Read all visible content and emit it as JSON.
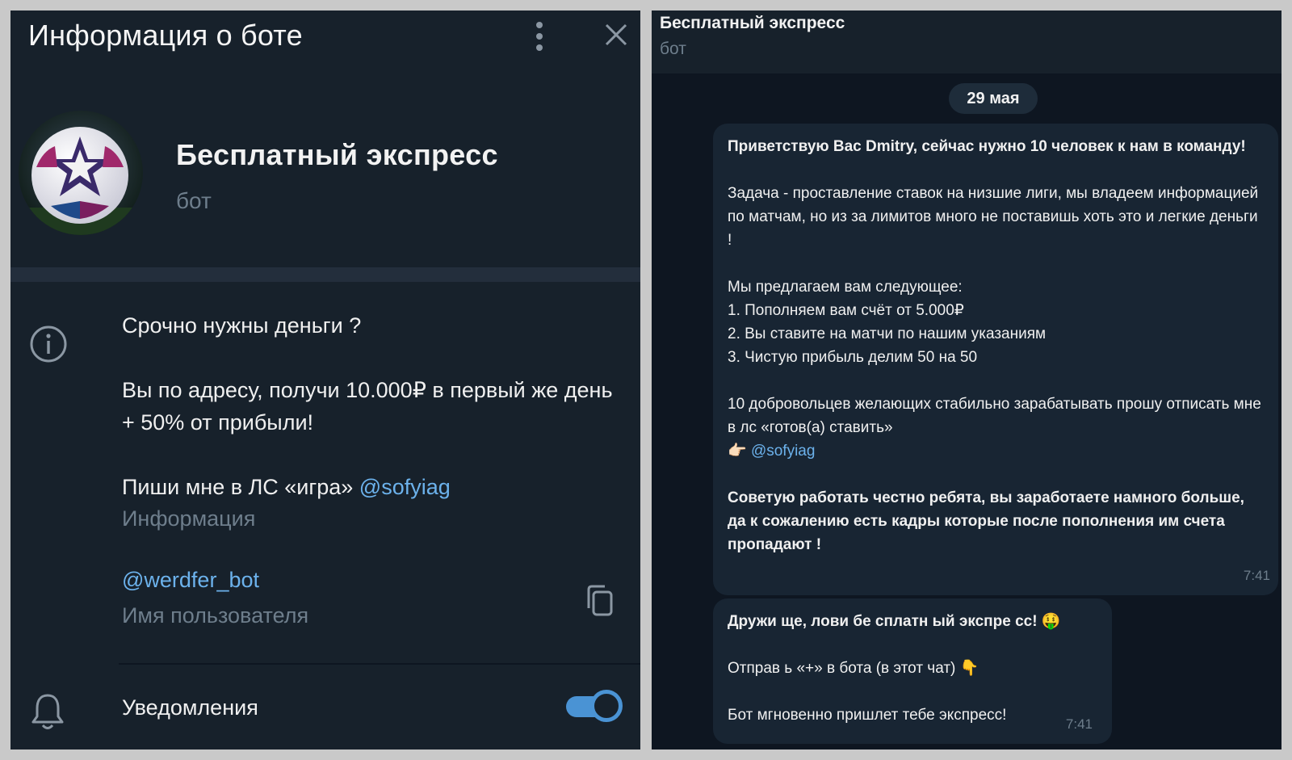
{
  "left_panel": {
    "title": "Информация о боте",
    "profile": {
      "name": "Бесплатный экспресс",
      "subtitle": "бот"
    },
    "description": {
      "line1": "Срочно нужны деньги ?",
      "line2": "Вы по адресу, получи 10.000₽ в первый же день + 50% от прибыли!",
      "line3_prefix": "Пиши мне в ЛС «игра» ",
      "line3_link": "@sofyiag",
      "label": "Информация"
    },
    "username": {
      "value": "@werdfer_bot",
      "label": "Имя пользователя"
    },
    "notifications": {
      "label": "Уведомления",
      "enabled": true
    },
    "colors": {
      "accent": "#4a93d4",
      "link": "#6cb2ec",
      "bg": "#17212b"
    }
  },
  "right_panel": {
    "header": {
      "title": "Бесплатный экспресс",
      "subtitle": "бот"
    },
    "date": "29 мая",
    "message1": {
      "p1": "Приветствую Вас Dmitry, сейчас нужно 10 человек к нам в команду!",
      "p2": "Задача - проставление ставок на низшие лиги, мы владеем информацией по матчам, но из за лимитов много не поставишь хоть это и легкие деньги !",
      "p3_l1": "Мы предлагаем вам следующее:",
      "p3_l2": "1. Пополняем вам счёт от 5.000₽",
      "p3_l3": "2. Вы ставите на матчи по нашим указаниям",
      "p3_l4": "3. Чистую прибыль делим 50 на 50",
      "p4": "10 добровольцев желающих стабильно зарабатывать прошу отписать мне в лс «готов(а) ставить»",
      "p4_emoji": "👉🏻",
      "p4_link": "@sofyiag",
      "p5": "Советую работать честно ребята, вы заработаете намного больше, да к сожалению есть кадры которые после пополнения им счета пропадают !",
      "time": "7:41"
    },
    "message2": {
      "l1": "Дружи ще, лови бе сплатн ый экспре сс!",
      "l1_emoji": "🤑",
      "l2": "Отправ ь «+» в бота (в этот чат)",
      "l2_emoji": "👇",
      "l3": "Бот мгновенно пришлет тебе экспресс!",
      "time": "7:41"
    }
  }
}
